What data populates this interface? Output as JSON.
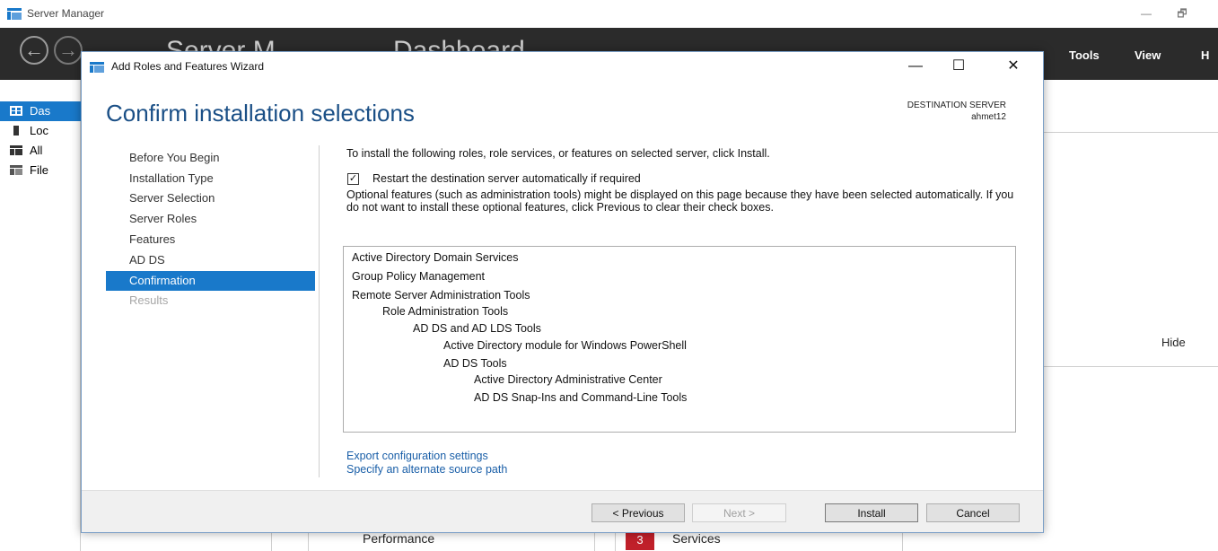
{
  "server_manager": {
    "window_title": "Server Manager",
    "minimize": "—",
    "restore": "🗗",
    "header_crumb_left": "Server M",
    "header_crumb_right": "Dashboard",
    "menu": [
      "Tools",
      "View",
      "H"
    ],
    "sidebar": [
      {
        "label": "Das",
        "icon": "dashboard-icon"
      },
      {
        "label": "Loc",
        "icon": "local-server-icon"
      },
      {
        "label": "All",
        "icon": "all-servers-icon"
      },
      {
        "label": "File",
        "icon": "file-services-icon"
      }
    ],
    "hide_label": "Hide",
    "bottom": {
      "performance": "Performance",
      "badge": "3",
      "services": "Services"
    }
  },
  "wizard": {
    "title": "Add Roles and Features Wizard",
    "heading": "Confirm installation selections",
    "destination_label": "DESTINATION SERVER",
    "destination_value": "ahmet12",
    "nav": [
      {
        "label": "Before You Begin",
        "state": "normal"
      },
      {
        "label": "Installation Type",
        "state": "normal"
      },
      {
        "label": "Server Selection",
        "state": "normal"
      },
      {
        "label": "Server Roles",
        "state": "normal"
      },
      {
        "label": "Features",
        "state": "normal"
      },
      {
        "label": "AD DS",
        "state": "normal"
      },
      {
        "label": "Confirmation",
        "state": "active"
      },
      {
        "label": "Results",
        "state": "disabled"
      }
    ],
    "intro": "To install the following roles, role services, or features on selected server, click Install.",
    "restart_checkbox": {
      "label": "Restart the destination server automatically if required",
      "checked": true,
      "mark": "✓"
    },
    "optional_text": "Optional features (such as administration tools) might be displayed on this page because they have been selected automatically. If you do not want to install these optional features, click Previous to clear their check boxes.",
    "selections": [
      {
        "text": "Active Directory Domain Services",
        "level": 0
      },
      {
        "text": "Group Policy Management",
        "level": 0
      },
      {
        "text": "Remote Server Administration Tools",
        "level": 0
      },
      {
        "text": "Role Administration Tools",
        "level": 1
      },
      {
        "text": "AD DS and AD LDS Tools",
        "level": 2
      },
      {
        "text": "Active Directory module for Windows PowerShell",
        "level": 3
      },
      {
        "text": "AD DS Tools",
        "level": 3
      },
      {
        "text": "Active Directory Administrative Center",
        "level": 4
      },
      {
        "text": "AD DS Snap-Ins and Command-Line Tools",
        "level": 4
      }
    ],
    "links": {
      "export": "Export configuration settings",
      "alternate_source": "Specify an alternate source path"
    },
    "buttons": {
      "previous": "< Previous",
      "next": "Next >",
      "install": "Install",
      "cancel": "Cancel"
    },
    "window_buttons": {
      "minimize": "—",
      "maximize": "☐",
      "close": "✕"
    }
  },
  "colors": {
    "accent": "#1979ca",
    "heading": "#1a4f86",
    "link": "#1a5fa8",
    "header_bg": "#2b2b2b",
    "badge": "#c0202a"
  }
}
